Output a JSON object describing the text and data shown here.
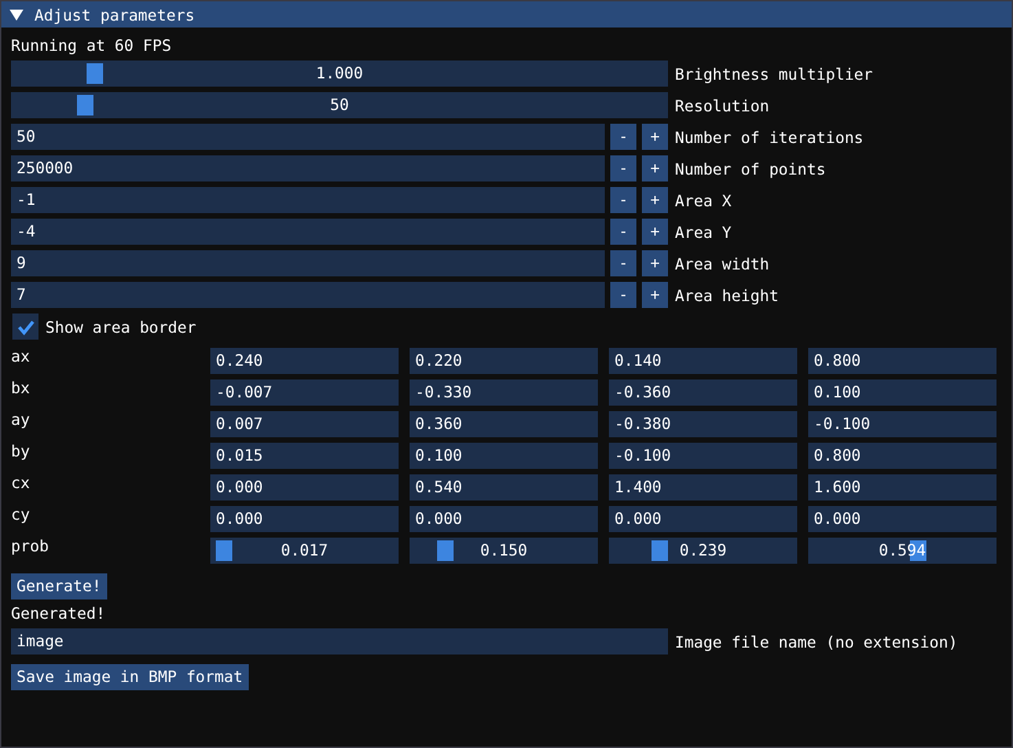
{
  "window": {
    "title": "Adjust parameters",
    "expanded": true
  },
  "fps_text": "Running at 60 FPS",
  "controls": [
    {
      "kind": "slider",
      "value": "1.000",
      "level": 0.114,
      "label": "Brightness multiplier"
    },
    {
      "kind": "slider",
      "value": "50",
      "level": 0.1,
      "label": "Resolution"
    },
    {
      "kind": "stepper",
      "value": "50",
      "minus": "-",
      "plus": "+",
      "label": "Number of iterations"
    },
    {
      "kind": "stepper",
      "value": "250000",
      "minus": "-",
      "plus": "+",
      "label": "Number of points"
    },
    {
      "kind": "stepper",
      "value": "-1",
      "minus": "-",
      "plus": "+",
      "label": "Area X"
    },
    {
      "kind": "stepper",
      "value": "-4",
      "minus": "-",
      "plus": "+",
      "label": "Area Y"
    },
    {
      "kind": "stepper",
      "value": "9",
      "minus": "-",
      "plus": "+",
      "label": "Area width"
    },
    {
      "kind": "stepper",
      "value": "7",
      "minus": "-",
      "plus": "+",
      "label": "Area height"
    }
  ],
  "checkbox": {
    "label": "Show area border",
    "checked": true
  },
  "matrix": [
    {
      "label": "ax",
      "kind": "input",
      "cells": [
        {
          "value": "0.240"
        },
        {
          "value": "0.220"
        },
        {
          "value": "0.140"
        },
        {
          "value": "0.800"
        }
      ]
    },
    {
      "label": "bx",
      "kind": "input",
      "cells": [
        {
          "value": "-0.007"
        },
        {
          "value": "-0.330"
        },
        {
          "value": "-0.360"
        },
        {
          "value": "0.100"
        }
      ]
    },
    {
      "label": "ay",
      "kind": "input",
      "cells": [
        {
          "value": "0.007"
        },
        {
          "value": "0.360"
        },
        {
          "value": "-0.380"
        },
        {
          "value": "-0.100"
        }
      ]
    },
    {
      "label": "by",
      "kind": "input",
      "cells": [
        {
          "value": "0.015"
        },
        {
          "value": "0.100"
        },
        {
          "value": "-0.100"
        },
        {
          "value": "0.800"
        }
      ]
    },
    {
      "label": "cx",
      "kind": "input",
      "cells": [
        {
          "value": "0.000"
        },
        {
          "value": "0.540"
        },
        {
          "value": "1.400"
        },
        {
          "value": "1.600"
        }
      ]
    },
    {
      "label": "cy",
      "kind": "input",
      "cells": [
        {
          "value": "0.000"
        },
        {
          "value": "0.000"
        },
        {
          "value": "0.000"
        },
        {
          "value": "0.000"
        }
      ]
    },
    {
      "label": "prob",
      "kind": "slider",
      "cells": [
        {
          "value": "0.017",
          "level": 0.017
        },
        {
          "value": "0.150",
          "level": 0.15
        },
        {
          "value": "0.239",
          "level": 0.239
        },
        {
          "value": "0.594",
          "level": 0.594
        }
      ]
    }
  ],
  "generate_button": "Generate!",
  "status": "Generated!",
  "filename": {
    "value": "image",
    "label": "Image file name (no extension)"
  },
  "save_button": "Save image in BMP format"
}
